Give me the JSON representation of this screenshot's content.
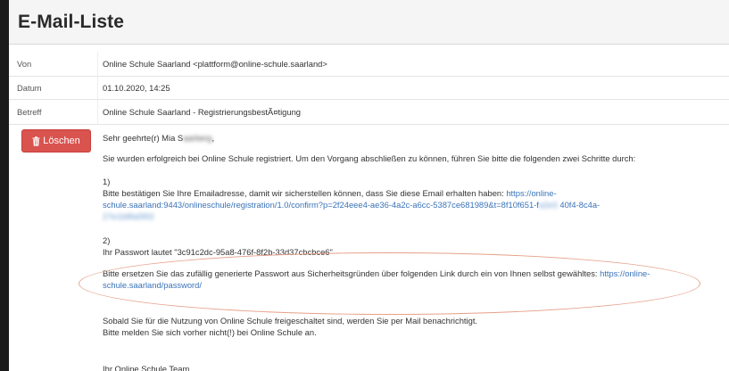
{
  "window": {
    "title": "E-Mail-Liste"
  },
  "fields": [
    {
      "label": "Von",
      "value": "Online Schule Saarland <plattform@online-schule.saarland>"
    },
    {
      "label": "Datum",
      "value": "01.10.2020, 14:25"
    },
    {
      "label": "Betreff",
      "value": "Online Schule Saarland - RegistrierungsbestÃ¤tigung"
    }
  ],
  "actions": {
    "delete_label": "Löschen",
    "delete_icon": "trash-icon",
    "delete_color": "#d9534f"
  },
  "message": {
    "greeting": "Sehr geehrte(r) Mia S",
    "greeting_blurred": "aarberg",
    "greeting_end": ",",
    "intro": "Sie wurden erfolgreich bei Online Schule registriert. Um den Vorgang abschließen zu können, führen Sie bitte die folgenden zwei Schritte durch:",
    "step1_number": "1)",
    "step1_text": "Bitte bestätigen Sie Ihre Emailadresse, damit wir sicherstellen können, dass Sie diese Email erhalten haben: ",
    "step1_link_line1": "https://online-",
    "step1_link_line2": "schule.saarland:9443/onlineschule/registration/1.0/confirm?p=2f24eee4-ae36-4a2c-a6cc-5387ce681989&t=8f10f651-f",
    "step1_link_blur1": "a2e3",
    "step1_link_line2_end": "40f4-8c4a-",
    "step1_link_blur2": "27e1b8fa5f93",
    "step2_number": "2)",
    "step2_text": "Ihr Passwort lautet \"3c91c2dc-95a8-476f-8f2b-33d37cbcbce6\"",
    "step2_reset_text": "Bitte ersetzen Sie das zufällig generierte Passwort aus Sicherheitsgründen über folgenden Link durch ein von Ihnen selbst gewähltes: ",
    "step2_link_line1": "https://online-",
    "step2_link_line2": "schule.saarland/password/",
    "closing_line1": "Sobald Sie für die Nutzung von Online Schule freigeschaltet sind, werden Sie per Mail benachrichtigt.",
    "closing_line2": "Bitte melden Sie sich vorher nicht(!) bei Online Schule an.",
    "signature": "Ihr Online Schule Team"
  },
  "colors": {
    "link": "#3a73b8",
    "annotation": "#e6a08a",
    "header_bg": "#f5f5f5"
  }
}
